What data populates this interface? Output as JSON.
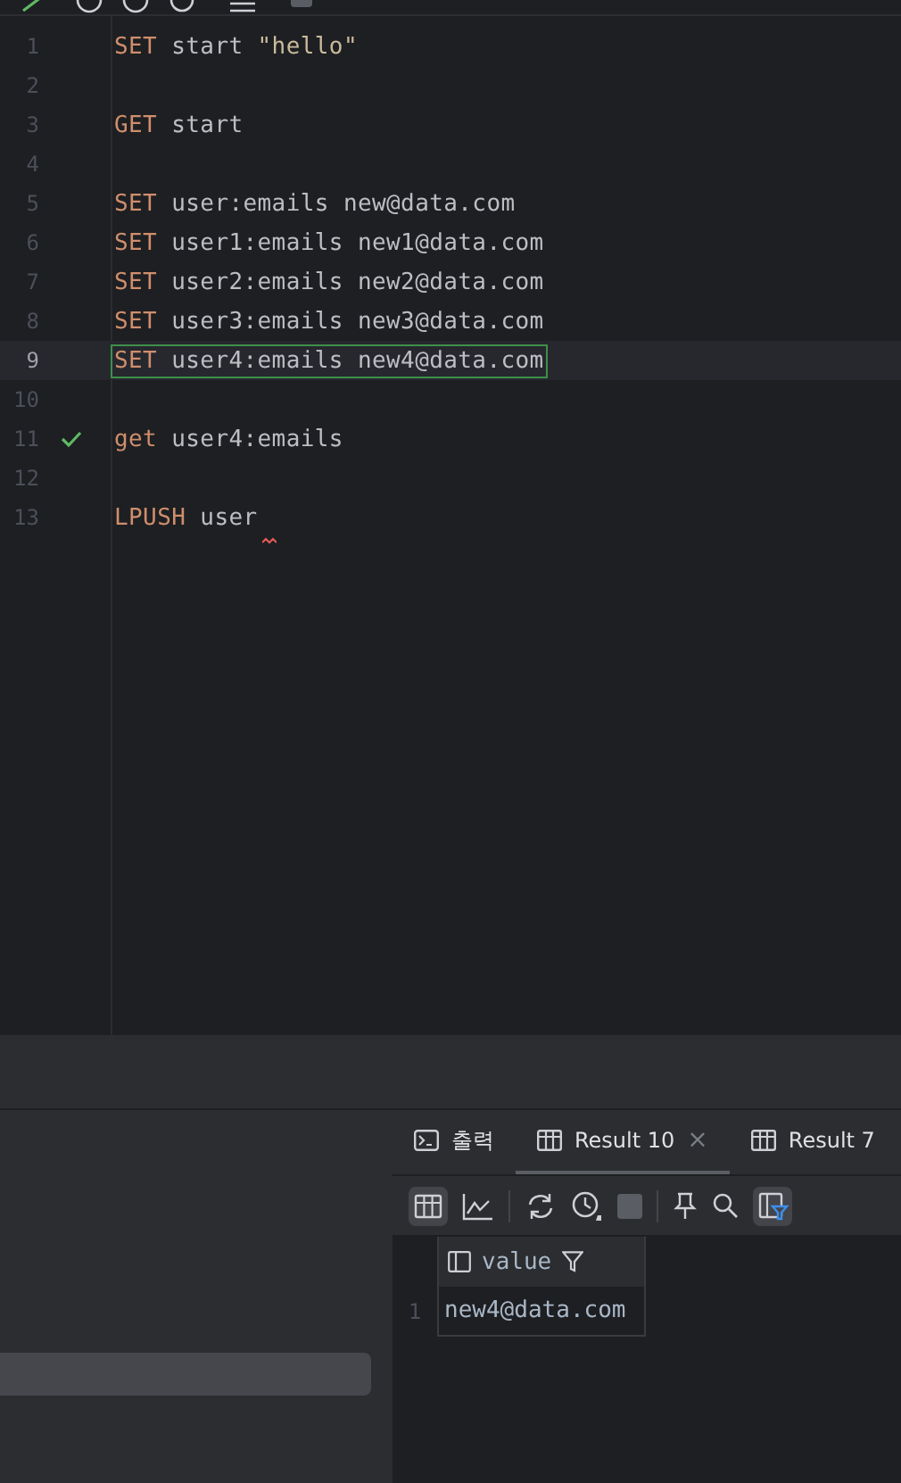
{
  "editor": {
    "lines": [
      {
        "number": "1",
        "current": false,
        "check": false,
        "error": false,
        "tokens": [
          {
            "kind": "keyword",
            "text": "SET"
          },
          {
            "kind": "text",
            "text": " start "
          },
          {
            "kind": "string",
            "text": "\"hello\""
          }
        ]
      },
      {
        "number": "2",
        "current": false,
        "check": false,
        "error": false
      },
      {
        "number": "3",
        "current": false,
        "check": false,
        "error": false,
        "tokens": [
          {
            "kind": "keyword",
            "text": "GET"
          },
          {
            "kind": "text",
            "text": " start"
          }
        ]
      },
      {
        "number": "4",
        "current": false,
        "check": false,
        "error": false
      },
      {
        "number": "5",
        "current": false,
        "check": false,
        "error": false,
        "tokens": [
          {
            "kind": "keyword",
            "text": "SET"
          },
          {
            "kind": "text",
            "text": " user:emails new@data.com"
          }
        ]
      },
      {
        "number": "6",
        "current": false,
        "check": false,
        "error": false,
        "tokens": [
          {
            "kind": "keyword",
            "text": "SET"
          },
          {
            "kind": "text",
            "text": " user1:emails new1@data.com"
          }
        ]
      },
      {
        "number": "7",
        "current": false,
        "check": false,
        "error": false,
        "tokens": [
          {
            "kind": "keyword",
            "text": "SET"
          },
          {
            "kind": "text",
            "text": " user2:emails new2@data.com"
          }
        ]
      },
      {
        "number": "8",
        "current": false,
        "check": false,
        "error": false,
        "tokens": [
          {
            "kind": "keyword",
            "text": "SET"
          },
          {
            "kind": "text",
            "text": " user3:emails new3@data.com"
          }
        ]
      },
      {
        "number": "9",
        "current": true,
        "check": false,
        "error": false,
        "tokens": [
          {
            "kind": "keyword",
            "text": "SET"
          },
          {
            "kind": "text",
            "text": " user4:emails new4@data.com"
          }
        ]
      },
      {
        "number": "10",
        "current": false,
        "check": false,
        "error": false
      },
      {
        "number": "11",
        "current": false,
        "check": true,
        "error": false,
        "tokens": [
          {
            "kind": "keyword",
            "text": "get"
          },
          {
            "kind": "text",
            "text": " user4:emails"
          }
        ]
      },
      {
        "number": "12",
        "current": false,
        "check": false,
        "error": false
      },
      {
        "number": "13",
        "current": false,
        "check": false,
        "error": true,
        "tokens": [
          {
            "kind": "keyword",
            "text": "LPUSH"
          },
          {
            "kind": "text",
            "text": " user"
          }
        ]
      }
    ]
  },
  "result_tabs": [
    {
      "kind": "output",
      "label": "출력",
      "selected": false,
      "closable": false
    },
    {
      "kind": "result",
      "label": "Result 10",
      "selected": true,
      "closable": true
    },
    {
      "kind": "result",
      "label": "Result 7",
      "selected": false,
      "closable": false
    }
  ],
  "close_glyph": "×",
  "result_table": {
    "columns": [
      "value"
    ],
    "rows": [
      {
        "number": "1",
        "cells": [
          "new4@data.com"
        ]
      }
    ]
  }
}
